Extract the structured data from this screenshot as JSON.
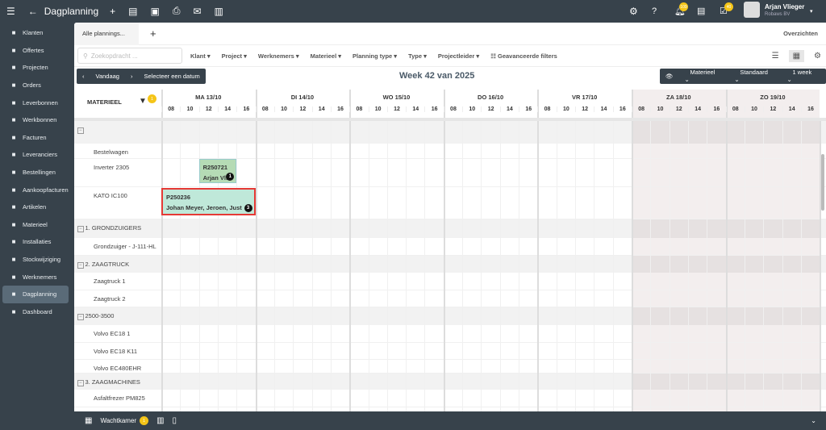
{
  "topbar": {
    "title": "Dagplanning",
    "user_name": "Arjan Vlieger",
    "company": "Robaws BV",
    "notif_badge": "109",
    "tasks_badge": "40"
  },
  "sidebar": {
    "items": [
      {
        "label": "Klanten",
        "icon": "building-icon"
      },
      {
        "label": "Offertes",
        "icon": "document-icon"
      },
      {
        "label": "Projecten",
        "icon": "star-icon"
      },
      {
        "label": "Orders",
        "icon": "list-icon"
      },
      {
        "label": "Leverbonnen",
        "icon": "receipt-icon"
      },
      {
        "label": "Werkbonnen",
        "icon": "wrench-icon"
      },
      {
        "label": "Facturen",
        "icon": "invoice-icon"
      },
      {
        "label": "Leveranciers",
        "icon": "contact-icon"
      },
      {
        "label": "Bestellingen",
        "icon": "cart-icon"
      },
      {
        "label": "Aankoopfacturen",
        "icon": "bank-icon"
      },
      {
        "label": "Artikelen",
        "icon": "tag-icon"
      },
      {
        "label": "Materieel",
        "icon": "truck-icon"
      },
      {
        "label": "Installaties",
        "icon": "tools-icon"
      },
      {
        "label": "Stockwijziging",
        "icon": "sync-icon"
      },
      {
        "label": "Werknemers",
        "icon": "person-icon"
      },
      {
        "label": "Dagplanning",
        "icon": "grid-icon",
        "active": true
      },
      {
        "label": "Dashboard",
        "icon": "chart-icon"
      }
    ]
  },
  "tabs": {
    "active": "Alle plannings...",
    "overviews": "Overzichten"
  },
  "filters": {
    "search_placeholder": "Zoekopdracht ...",
    "items": [
      "Klant",
      "Project",
      "Werknemers",
      "Materieel",
      "Planning type",
      "Type",
      "Projectleider"
    ],
    "advanced": "Geavanceerde filters"
  },
  "nav": {
    "today": "Vandaag",
    "select_date": "Selecteer een datum",
    "week_title": "Week 42 van 2025",
    "view": "Materieel",
    "mode": "Standaard",
    "range": "1 week"
  },
  "grid": {
    "header": "MATERIEEL",
    "filter_badge": "1",
    "days": [
      {
        "label": "MA 13/10",
        "weekend": false
      },
      {
        "label": "DI 14/10",
        "weekend": false
      },
      {
        "label": "WO 15/10",
        "weekend": false
      },
      {
        "label": "DO 16/10",
        "weekend": false
      },
      {
        "label": "VR 17/10",
        "weekend": false
      },
      {
        "label": "ZA 18/10",
        "weekend": true
      },
      {
        "label": "ZO 19/10",
        "weekend": true
      }
    ],
    "hours": [
      "08",
      "10",
      "12",
      "14",
      "16"
    ],
    "rows": [
      {
        "label": "",
        "group": true
      },
      {
        "label": "Bestelwagen"
      },
      {
        "label": "Inverter 2305"
      },
      {
        "label": "KATO IC100"
      },
      {
        "label": "1. GRONDZUIGERS",
        "group": true
      },
      {
        "label": "Grondzuiger - J-111-HL"
      },
      {
        "label": "2. ZAAGTRUCK",
        "group": true
      },
      {
        "label": "Zaagtruck 1"
      },
      {
        "label": "Zaagtruck 2"
      },
      {
        "label": "2500-3500",
        "group": true
      },
      {
        "label": "Volvo EC18 1"
      },
      {
        "label": "Volvo EC18 K11"
      },
      {
        "label": "Volvo EC480EHR"
      },
      {
        "label": "3. ZAAGMACHINES",
        "group": true
      },
      {
        "label": "Asfaltfrezer PM825"
      }
    ],
    "events": [
      {
        "code": "R250721",
        "people": "Arjan Vli",
        "count": "1",
        "color": "#b5dbb5"
      },
      {
        "code": "P250236",
        "people": "Johan Meyer, Jeroen, Just",
        "count": "3",
        "color": "#bfe8d9",
        "selected": true
      }
    ]
  },
  "bottom": {
    "waiting_room": "Wachtkamer",
    "badge": "1"
  }
}
